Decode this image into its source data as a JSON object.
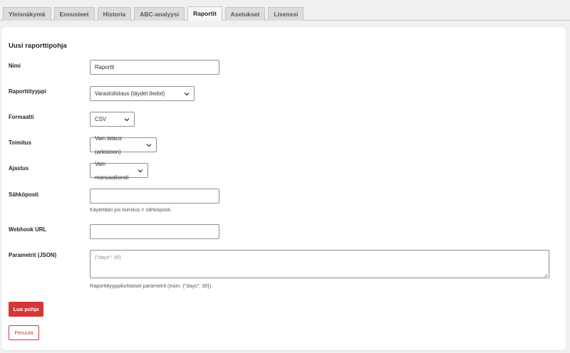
{
  "tabs": [
    {
      "label": "Yleisnäkymä"
    },
    {
      "label": "Ennusteet"
    },
    {
      "label": "Historia"
    },
    {
      "label": "ABC-analyysi"
    },
    {
      "label": "Raportit"
    },
    {
      "label": "Asetukset"
    },
    {
      "label": "Lisenssi"
    }
  ],
  "active_tab": "Raportit",
  "form": {
    "title": "Uusi raporttipohja",
    "name": {
      "label": "Nimi",
      "value": "Raportti"
    },
    "report_type": {
      "label": "Raporttityyppi",
      "value": "Varastolistaus (täydet tiedot)"
    },
    "format": {
      "label": "Formaatti",
      "value": "CSV"
    },
    "delivery": {
      "label": "Toimitus",
      "value": "Vain lataus (arkistoon)"
    },
    "schedule": {
      "label": "Ajastus",
      "value": "Vain manuaalisesti"
    },
    "email": {
      "label": "Sähköposti",
      "value": "",
      "help": "Käytetään jos toimitus = sähköposti."
    },
    "webhook": {
      "label": "Webhook URL",
      "value": ""
    },
    "params": {
      "label": "Parametrit (JSON)",
      "placeholder": "{\"days\": 30}",
      "help": "Raporttityyppikohtaiset parametrit (esim. {\"days\": 30})."
    },
    "submit_label": "Luo pohja",
    "cancel_label": "Peruuta"
  },
  "colors": {
    "accent": "#d63638",
    "background": "#f0f0f1",
    "card": "#ffffff"
  }
}
